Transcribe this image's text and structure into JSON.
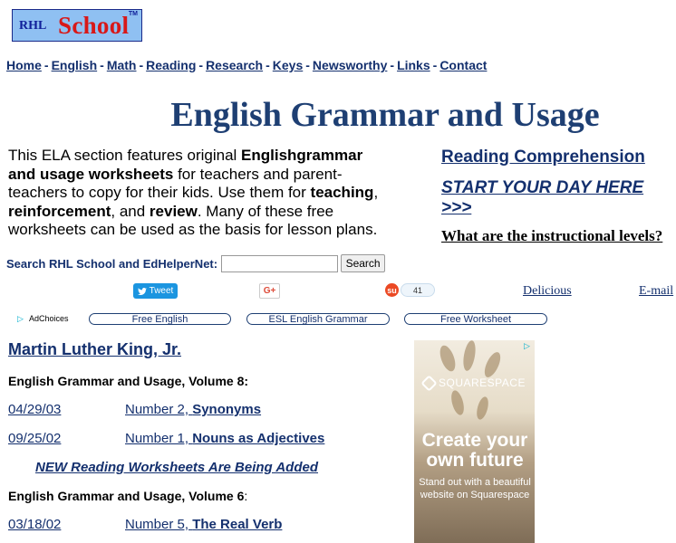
{
  "logo": {
    "prefix": "RHL",
    "name": "School",
    "tm": "TM"
  },
  "nav": {
    "items": [
      "Home",
      "English",
      "Math",
      "Reading",
      "Research",
      "Keys",
      "Newsworthy",
      "Links",
      "Contact"
    ],
    "separator": "-"
  },
  "page": {
    "title": "English Grammar and Usage"
  },
  "intro": {
    "t1": "This ELA section features original ",
    "b1": "Englishgrammar and usage worksheets",
    "t2": " for teachers and parent-teachers to copy for their kids. Use them for ",
    "b2": "teaching",
    "t3": ", ",
    "b3": "reinforcement",
    "t4": ", and ",
    "b4": "review",
    "t5": ". Many of these free worksheets can be used as the basis for lesson plans."
  },
  "side_links": {
    "reading": "Reading Comprehension",
    "start": "START YOUR DAY HERE >>>",
    "levels": "What are the instructional levels?"
  },
  "search": {
    "label": "Search RHL School and EdHelperNet:",
    "value": "",
    "button": "Search"
  },
  "share": {
    "tweet": "Tweet",
    "gplus": "G+",
    "stumble_count": "41",
    "delicious": "Delicious",
    "email": "E-mail"
  },
  "ads": {
    "adchoices": "AdChoices",
    "pills": [
      "Free English",
      "ESL English Grammar",
      "Free Worksheet"
    ]
  },
  "content": {
    "featured_link": "Martin Luther King, Jr.",
    "volume8": "English Grammar and Usage, Volume 8:",
    "volume6_title": "English Grammar and Usage, Volume 6",
    "volume6_colon": ":",
    "rows": [
      {
        "date": "04/29/03",
        "num": "Number 2, ",
        "name": "Synonyms"
      },
      {
        "date": "09/25/02",
        "num": "Number 1, ",
        "name": "Nouns as Adjectives"
      },
      {
        "date": "03/18/02",
        "num": "Number 5, ",
        "name": "The Real Verb"
      }
    ],
    "new_notice": "NEW Reading Worksheets Are Being Added"
  },
  "sidebar_ad": {
    "brand": "SQUARESPACE",
    "headline": "Create your own future",
    "sub": "Stand out with a beautiful website on Squarespace"
  },
  "colors": {
    "link": "#14306e",
    "title": "#1e3f73",
    "logo_bg": "#8fc0f2",
    "logo_red": "#d81818",
    "tweet_blue": "#1b95e0"
  }
}
